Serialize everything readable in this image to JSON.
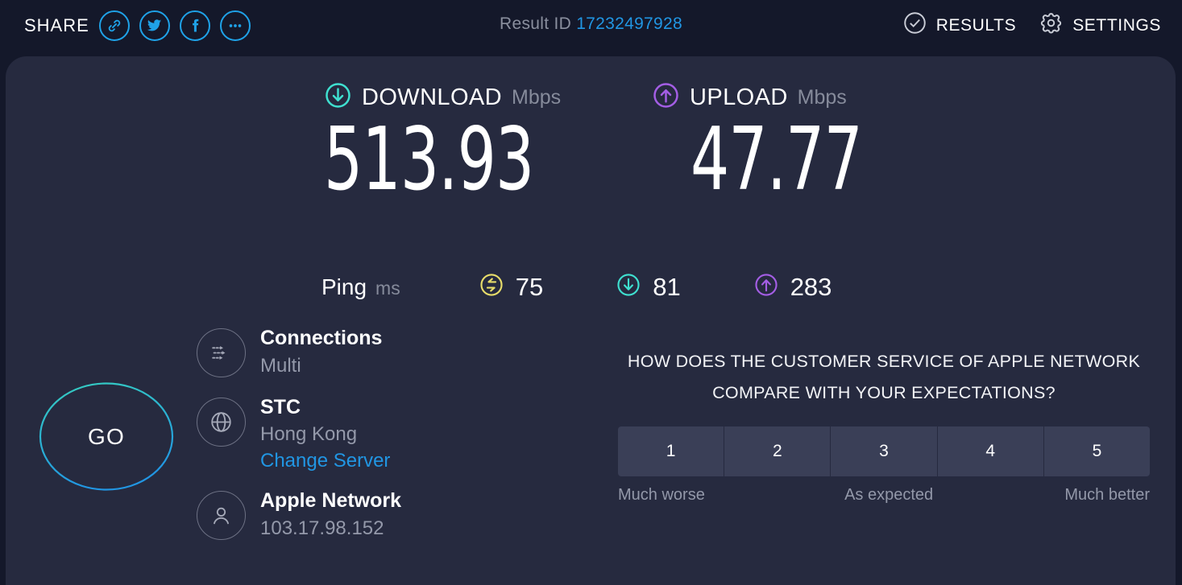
{
  "topbar": {
    "share_label": "SHARE",
    "share_icons": [
      "link-icon",
      "twitter-icon",
      "facebook-icon",
      "more-icon"
    ],
    "result_id_label": "Result ID",
    "result_id_value": "17232497928",
    "results_label": "RESULTS",
    "settings_label": "SETTINGS",
    "accent_blue": "#1fa2e8"
  },
  "speeds": {
    "download": {
      "title": "DOWNLOAD",
      "unit": "Mbps",
      "value": "513.93",
      "icon": "download-arrow-icon",
      "color": "#3fe0d0"
    },
    "upload": {
      "title": "UPLOAD",
      "unit": "Mbps",
      "value": "47.77",
      "icon": "upload-arrow-icon",
      "color": "#a45ee5"
    }
  },
  "ping": {
    "label": "Ping",
    "unit": "ms",
    "idle": {
      "icon": "jitter-icon",
      "value": "75",
      "color": "#e8dd6a"
    },
    "download": {
      "icon": "download-arrow-icon",
      "value": "81",
      "color": "#3fe0d0"
    },
    "upload": {
      "icon": "upload-arrow-icon",
      "value": "283",
      "color": "#a45ee5"
    }
  },
  "go_button": {
    "label": "GO"
  },
  "info": {
    "connections": {
      "title": "Connections",
      "value": "Multi",
      "icon": "multi-connection-icon"
    },
    "server": {
      "title": "STC",
      "value": "Hong Kong",
      "link": "Change Server",
      "icon": "globe-icon"
    },
    "isp": {
      "title": "Apple Network",
      "value": "103.17.98.152",
      "icon": "user-icon"
    }
  },
  "survey": {
    "question": "HOW DOES THE CUSTOMER SERVICE OF APPLE NETWORK COMPARE WITH YOUR EXPECTATIONS?",
    "options": [
      "1",
      "2",
      "3",
      "4",
      "5"
    ],
    "scale_low": "Much worse",
    "scale_mid": "As expected",
    "scale_high": "Much better"
  }
}
